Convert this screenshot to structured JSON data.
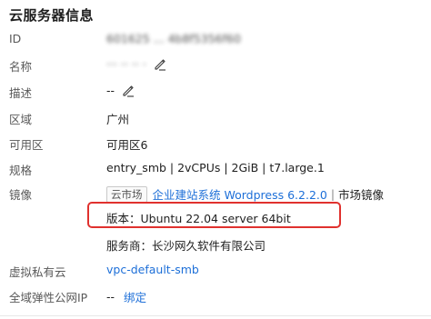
{
  "panel": {
    "title": "云服务器信息"
  },
  "rows": {
    "id": {
      "label": "ID",
      "value": "601625 ... 4b8f5356f60"
    },
    "name": {
      "label": "名称",
      "value": "··· ·· ·· ·"
    },
    "description": {
      "label": "描述",
      "value": "--"
    },
    "region": {
      "label": "区域",
      "value": "广州"
    },
    "zone": {
      "label": "可用区",
      "value": "可用区6"
    },
    "spec": {
      "label": "规格",
      "value": "entry_smb | 2vCPUs | 2GiB | t7.large.1"
    },
    "image": {
      "label": "镜像",
      "tag": "云市场",
      "link": "企业建站系统 Wordpress 6.2.2.0",
      "separator": "|",
      "suffix": "市场镜像",
      "version_line": "版本：Ubuntu 22.04 server 64bit",
      "provider_line": "服务商：长沙网久软件有限公司"
    },
    "vpc": {
      "label": "虚拟私有云",
      "value": "vpc-default-smb"
    },
    "eip": {
      "label": "全域弹性公网IP",
      "value": "--",
      "action": "绑定"
    }
  },
  "colors": {
    "link": "#1d6fd8",
    "highlight_border": "#e0312e",
    "label": "#595959"
  },
  "icons": [
    "edit-icon"
  ]
}
